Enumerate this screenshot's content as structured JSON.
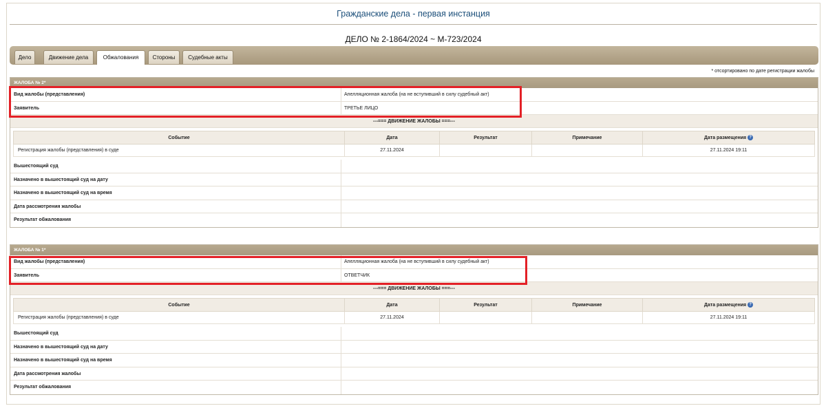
{
  "header": {
    "title": "Гражданские дела - первая инстанция",
    "case_number": "ДЕЛО № 2-1864/2024 ~ М-723/2024"
  },
  "tabs": [
    {
      "label": "Дело"
    },
    {
      "label": "Движение дела"
    },
    {
      "label": "Обжалования"
    },
    {
      "label": "Стороны"
    },
    {
      "label": "Судебные акты"
    }
  ],
  "sort_note": "* отсортировано по дате регистрации жалобы",
  "labels": {
    "complaint_type": "Вид жалобы (представления)",
    "applicant": "Заявитель",
    "movement_header": "---=== ДВИЖЕНИЕ ЖАЛОБЫ ===---",
    "col_event": "Событие",
    "col_date": "Дата",
    "col_result": "Результат",
    "col_note": "Примечание",
    "col_posted": "Дата размещения",
    "higher_court": "Вышестоящий суд",
    "assigned_date": "Назначено в вышестоящий суд на дату",
    "assigned_time": "Назначено в вышестоящий суд на время",
    "review_date": "Дата рассмотрения жалобы",
    "result": "Результат обжалования"
  },
  "complaints": [
    {
      "title": "ЖАЛОБА № 2*",
      "type": "Апелляционная жалоба (на не вступивший в силу судебный акт)",
      "applicant": "ТРЕТЬЕ ЛИЦО",
      "event": "Регистрация жалобы (представления) в суде",
      "date": "27.11.2024",
      "result": "",
      "note": "",
      "posted": "27.11.2024 19:11"
    },
    {
      "title": "ЖАЛОБА № 1*",
      "type": "Апелляционная жалоба (на не вступивший в силу судебный акт)",
      "applicant": "ОТВЕТЧИК",
      "event": "Регистрация жалобы (представления) в суде",
      "date": "27.11.2024",
      "result": "",
      "note": "",
      "posted": "27.11.2024 19:11"
    }
  ],
  "accent_colors": {
    "highlight": "#e32026",
    "tab_bar": "#b0a186",
    "title": "#1c4f7a"
  },
  "icons": {
    "help": "help-icon"
  }
}
